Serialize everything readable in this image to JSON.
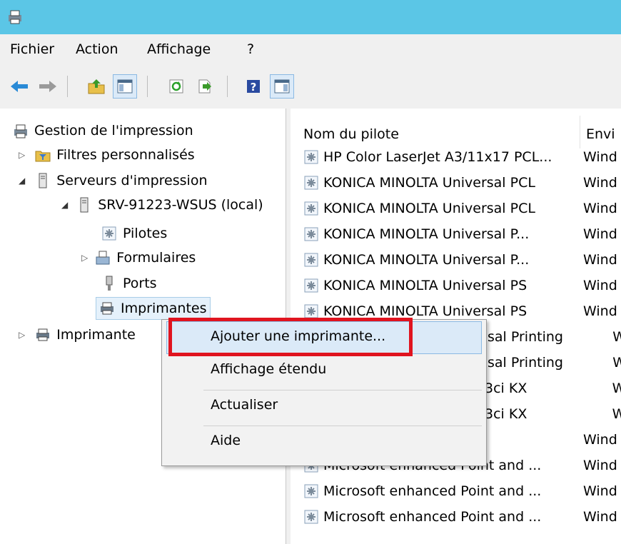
{
  "menu": [
    "Fichier",
    "Action",
    "Affichage",
    "?"
  ],
  "toolbar": [
    "back-icon",
    "forward-icon",
    "up-folder-icon",
    "show-tree-icon",
    "refresh-icon",
    "export-icon",
    "help-icon",
    "show-action-pane-icon"
  ],
  "tree": {
    "root": "Gestion de l'impression",
    "filters": "Filtres personnalisés",
    "servers": "Serveurs d'impression",
    "server": "SRV-91223-WSUS (local)",
    "drivers": "Pilotes",
    "forms": "Formulaires",
    "ports": "Ports",
    "printers": "Imprimantes",
    "deployed": "Imprimante"
  },
  "columns": [
    "Nom du pilote",
    "Envi"
  ],
  "rows": [
    {
      "name": "HP Color LaserJet A3/11x17 PCL...",
      "env": "Wind"
    },
    {
      "name": "KONICA MINOLTA Universal PCL",
      "env": "Wind"
    },
    {
      "name": "KONICA MINOLTA Universal PCL",
      "env": "Wind"
    },
    {
      "name": "KONICA MINOLTA Universal P...",
      "env": "Wind"
    },
    {
      "name": "KONICA MINOLTA Universal P...",
      "env": "Wind"
    },
    {
      "name": "KONICA MINOLTA Universal PS",
      "env": "Wind"
    },
    {
      "name": "KONICA MINOLTA Universal PS",
      "env": "Wind"
    },
    {
      "name": "sal Printing",
      "env": "Wind"
    },
    {
      "name": "sal Printing",
      "env": "Wind"
    },
    {
      "name": "3ci KX",
      "env": "Wind"
    },
    {
      "name": "3ci KX",
      "env": "Wind"
    },
    {
      "name": "",
      "env": "Wind"
    },
    {
      "name": "Microsoft enhanced Point and ...",
      "env": "Wind"
    },
    {
      "name": "Microsoft enhanced Point and ...",
      "env": "Wind"
    },
    {
      "name": "Microsoft enhanced Point and ...",
      "env": "Wind"
    }
  ],
  "context_menu": [
    "Ajouter une imprimante...",
    "Affichage étendu",
    "Actualiser",
    "Aide"
  ],
  "colors": {
    "titlebar": "#5bc6e6",
    "highlight": "#e0141f"
  }
}
